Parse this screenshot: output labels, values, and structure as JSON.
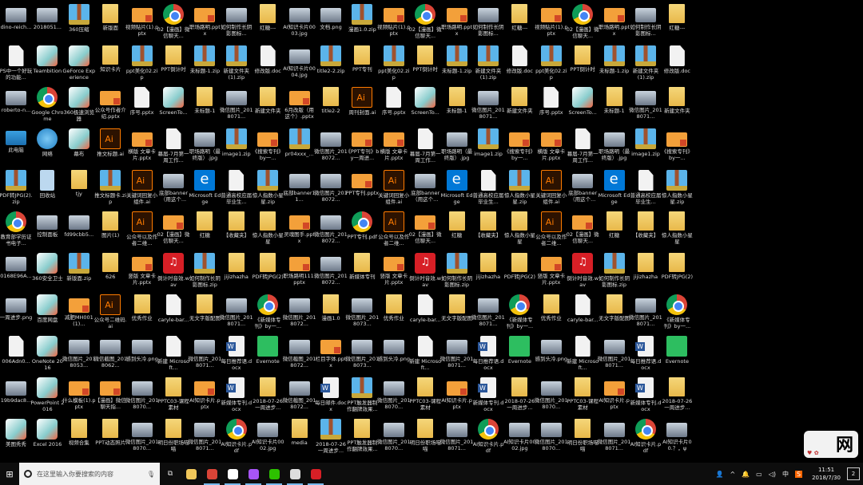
{
  "desktop": {
    "rows": [
      {
        "labels": [
          "dino-reich...",
          "2018051...",
          "360压缩",
          "新版面",
          "视频贴片(1).pptx",
          "02【漫画】微信聊天...",
          "职场路明.pptx",
          "如何制作长阴影图标...",
          "红糖---",
          "AI知识卡片0003.jpg",
          "文档.png",
          "漫画1.0.zip",
          "视频贴片(1).pptx",
          "02【漫画】微信聊天...",
          "职场路明.pptx",
          "如何制作长阴影图标...",
          "红糖---",
          "视频贴片(1).pptx",
          "02【漫画】微信聊天...",
          "职场路明.pptx",
          "如何制作长阴影图标...",
          "红糖---"
        ],
        "icons": [
          "img",
          "img",
          "zip",
          "folder",
          "ppt",
          "chrome",
          "ppt",
          "img",
          "folder",
          "img",
          "img",
          "zip",
          "ppt",
          "chrome",
          "ppt",
          "img",
          "folder",
          "ppt",
          "chrome",
          "ppt",
          "img",
          "folder"
        ]
      },
      {
        "labels": [
          "PS中一个好玩的功能...",
          "Teambition",
          "GeForce Experience",
          "知识卡片",
          "ppt美化02.zip",
          "PPT倒计时",
          "未标题-1.zip",
          "新建文件夹(1).zip",
          "修改版.doc",
          "AI知识卡片0004.jpg",
          "title2-2.zip",
          "PPT专刊",
          "ppt美化02.zip",
          "PPT倒计时",
          "未标题-1.zip",
          "新建文件夹(1).zip",
          "修改版.doc",
          "ppt美化02.zip",
          "PPT倒计时",
          "未标题-1.zip",
          "新建文件夹(1).zip",
          "修改版.doc"
        ],
        "icons": [
          "doc",
          "app",
          "app",
          "folder",
          "zip",
          "folder",
          "zip",
          "zip",
          "doc",
          "img",
          "zip",
          "folder",
          "zip",
          "folder",
          "zip",
          "zip",
          "doc",
          "zip",
          "folder",
          "zip",
          "zip",
          "doc"
        ]
      },
      {
        "labels": [
          "roberto-n...",
          "Google Chrome",
          "360极速浏览器",
          "公众号作者介绍.pptx",
          "序号.pptx",
          "ScreenTo...",
          "未标题-1",
          "微信图片_2018071...",
          "新建文件夹",
          "6月改版（用这个）.pptx",
          "title2-2",
          "周刊封面.ai",
          "序号.pptx",
          "ScreenTo...",
          "未标题-1",
          "微信图片_2018071...",
          "新建文件夹",
          "序号.pptx",
          "ScreenTo...",
          "未标题-1",
          "微信图片_2018071...",
          "新建文件夹"
        ],
        "icons": [
          "img",
          "chrome",
          "app",
          "ppt",
          "doc",
          "app",
          "folder",
          "img",
          "folder",
          "ppt",
          "folder",
          "ai",
          "doc",
          "app",
          "folder",
          "img",
          "folder",
          "doc",
          "app",
          "folder",
          "img",
          "folder"
        ]
      },
      {
        "labels": [
          "此电脑",
          "网络",
          "幕布",
          "推文标题.ai",
          "横版 文章卡片.pptx",
          "幕届-7月第一周工作...",
          "职场路明（最终版）.jpg",
          "image1.zip",
          "《搜索专刊》by一...",
          "pr04xxx_...",
          "微信图片_2018072...",
          "《PPT专刊》by一周进...",
          "横版 文章卡片.pptx",
          "幕届-7月第一周工作...",
          "职场路明（最终版）.jpg",
          "image1.zip",
          "《搜索专刊》by一...",
          "横版 文章卡片.pptx",
          "幕届-7月第一周工作...",
          "职场路明（最终版）.jpg",
          "image1.zip",
          "《搜索专刊》by一..."
        ],
        "icons": [
          "pc",
          "net",
          "app",
          "ai",
          "ppt",
          "doc",
          "img",
          "zip",
          "ppt",
          "zip",
          "img",
          "ppt",
          "ppt",
          "doc",
          "img",
          "zip",
          "ppt",
          "ppt",
          "doc",
          "img",
          "zip",
          "ppt"
        ]
      },
      {
        "labels": [
          "PDF转JPG(2).zip",
          "回收站",
          "tjy",
          "推文标题卡.zip",
          "关键词回复小组件.ai",
          "底部banner（用这个...",
          "Microsoft Edge",
          "普通高校应届毕业生...",
          "惊人指数小星星.zip",
          "底部banner11...",
          "微信图片_2018072...",
          "PPT专刊.pptx",
          "关键词回复小组件.ai",
          "底部banner（用这个...",
          "Microsoft Edge",
          "普通高校应届毕业生...",
          "惊人指数小星星.zip",
          "关键词回复小组件.ai",
          "底部banner（用这个...",
          "Microsoft Edge",
          "普通高校应届毕业生...",
          "惊人指数小星星.zip"
        ],
        "icons": [
          "zip",
          "recycle",
          "folder",
          "zip",
          "ai",
          "img",
          "edge",
          "doc",
          "zip",
          "img",
          "img",
          "ppt",
          "ai",
          "img",
          "edge",
          "doc",
          "zip",
          "ai",
          "img",
          "edge",
          "doc",
          "zip"
        ]
      },
      {
        "labels": [
          "教育部学历证书电子...",
          "控制面板",
          "fd99cbb5...",
          "图片(1)",
          "公众号以及作者二维...",
          "02【漫画】微信聊天...",
          "红糖",
          "【收藏夹】",
          "惊人指数小星星",
          "灵魂图手.pptx",
          "微信图片_2018072...",
          "PPT专刊.pdf",
          "公众号以及作者二维...",
          "02【漫画】微信聊天...",
          "红糖",
          "【收藏夹】",
          "惊人指数小星星",
          "公众号以及作者二维...",
          "02【漫画】微信聊天...",
          "红糖",
          "【收藏夹】",
          "惊人指数小星星"
        ],
        "icons": [
          "chrome",
          "img",
          "img",
          "folder",
          "ai",
          "ppt",
          "folder",
          "folder",
          "folder",
          "ppt",
          "img",
          "chrome",
          "ai",
          "ppt",
          "folder",
          "folder",
          "folder",
          "ai",
          "ppt",
          "folder",
          "folder",
          "folder"
        ]
      },
      {
        "labels": [
          "0168E96A...",
          "360安全卫士",
          "新版面.zip",
          "626",
          "竖版 文章卡片.pptx",
          "倒计时音效.wav",
          "如何制作长阴影图标.zip",
          "jijizhazha",
          "PDF转JPG(2)",
          "职场路明111.pptx",
          "微信图片_2018072...",
          "新媒体专刊",
          "竖版 文章卡片.pptx",
          "倒计时音效.wav",
          "如何制作长阴影图标.zip",
          "jijizhazha",
          "PDF转JPG(2)",
          "竖版 文章卡片.pptx",
          "倒计时音效.wav",
          "如何制作长阴影图标.zip",
          "jijizhazha",
          "PDF转JPG(2)"
        ],
        "icons": [
          "img",
          "app",
          "zip",
          "folder",
          "ppt",
          "music",
          "zip",
          "folder",
          "folder",
          "ppt",
          "img",
          "folder",
          "ppt",
          "music",
          "zip",
          "folder",
          "folder",
          "ppt",
          "music",
          "zip",
          "folder",
          "folder"
        ]
      },
      {
        "labels": [
          "一周进步.png",
          "百度网盘",
          "减肥MH001(1)...",
          "公众号二维码.ai",
          "优秀作业",
          "caryle-bar...",
          "无文字版配图",
          "微信图片_2018071...",
          "《新媒体专刊》by一...",
          "微信图片_2018072...",
          "漫画1.0",
          "微信图片_2018073...",
          "优秀作业",
          "caryle-bar...",
          "无文字版配图",
          "微信图片_2018071...",
          "《新媒体专刊》by一...",
          "优秀作业",
          "caryle-bar...",
          "无文字版配图",
          "微信图片_2018071...",
          "《新媒体专刊》by一..."
        ],
        "icons": [
          "img",
          "app",
          "ppt",
          "ai",
          "folder",
          "doc",
          "folder",
          "img",
          "chrome",
          "img",
          "folder",
          "img",
          "folder",
          "doc",
          "folder",
          "img",
          "chrome",
          "folder",
          "doc",
          "folder",
          "img",
          "chrome"
        ]
      },
      {
        "labels": [
          "006Adn0...",
          "OneNote 2016",
          "微信图片_2018053...",
          "微信截图_2018062...",
          "感到头冷.png",
          "新建 Microsoft...",
          "微信图片_2018071...",
          "每日推荐语.docx",
          "Evernote",
          "微信截图_2018072...",
          "栏目字体.pptx",
          "微信图片_2018073...",
          "感到头冷.png",
          "新建 Microsoft...",
          "微信图片_2018071...",
          "每日推荐语.docx",
          "Evernote",
          "感到头冷.png",
          "新建 Microsoft...",
          "微信图片_2018071...",
          "每日推荐语.docx",
          "Evernote"
        ],
        "icons": [
          "doc",
          "app",
          "img",
          "img",
          "img",
          "doc",
          "img",
          "word",
          "evernote",
          "img",
          "ppt",
          "img",
          "img",
          "doc",
          "img",
          "word",
          "evernote",
          "img",
          "doc",
          "img",
          "word",
          "evernote"
        ]
      },
      {
        "labels": [
          "19b9dac8...",
          "PowerPoint 2016",
          "什么模板(1).pptx",
          "【漫画】微信聊天指...",
          "微信图片_2018070...",
          "PPTC03-课程素材",
          "AI知识卡片.pptx",
          "新媒体专刊.docx",
          "2018-07-26一周进步...",
          "微信截图_2018072...",
          "每日邮件.docx",
          "PPT触发器制作翻牌效果...",
          "微信图片_2018070...",
          "PPTC03-课程素材",
          "AI知识卡片.pptx",
          "新媒体专刊.docx",
          "2018-07-26一周进步...",
          "微信图片_2018070...",
          "PPTC03-课程素材",
          "AI知识卡片.pptx",
          "新媒体专刊.docx",
          "2018-07-26一周进步..."
        ],
        "icons": [
          "img",
          "app",
          "ppt",
          "ppt",
          "img",
          "folder",
          "ppt",
          "word",
          "folder",
          "img",
          "word",
          "zip",
          "img",
          "folder",
          "ppt",
          "word",
          "folder",
          "img",
          "folder",
          "ppt",
          "word",
          "folder"
        ]
      },
      {
        "labels": [
          "美图秀秀",
          "Excel 2016",
          "视频合集",
          "PPT动态照片",
          "微信图片_2018070...",
          "明日份职场喵喵",
          "微信图片_2018071...",
          "AI知识卡片.pdf",
          "AI知识卡片0002.jpg",
          "media",
          "2018-07-26一周进步...",
          "PPT触发器制作翻牌效果...",
          "微信图片_2018070...",
          "明日份职场喵喵",
          "微信图片_2018071...",
          "AI知识卡片.pdf",
          "AI知识卡片0002.jpg",
          "微信图片_2018070...",
          "明日份职场喵喵",
          "微信图片_2018071...",
          "AI知识卡片.pdf",
          "AI知识卡片00.？，ψ"
        ],
        "icons": [
          "app",
          "app",
          "folder",
          "folder",
          "img",
          "folder",
          "img",
          "chrome",
          "img",
          "folder",
          "zip",
          "folder",
          "img",
          "folder",
          "img",
          "chrome",
          "img",
          "img",
          "folder",
          "img",
          "chrome",
          "img"
        ]
      }
    ]
  },
  "taskbar": {
    "search_placeholder": "在这里输入你要搜索的内容",
    "pinned": [
      {
        "name": "file-explorer",
        "color": "#f0c75a",
        "open": false
      },
      {
        "name": "chrome",
        "color": "#db4437",
        "open": true
      },
      {
        "name": "teambition",
        "color": "#ffffff",
        "open": true
      },
      {
        "name": "360-browser",
        "color": "#a855f7",
        "open": true
      },
      {
        "name": "wechat",
        "color": "#2dc100",
        "open": true
      },
      {
        "name": "mubu",
        "color": "#dddddd",
        "open": true
      },
      {
        "name": "netease-music",
        "color": "#d71f26",
        "open": true
      }
    ],
    "tray": {
      "ime": "中",
      "time": "11:51",
      "date": "2018/7/30",
      "notifications": "2"
    }
  },
  "watermark": {
    "text": "网"
  }
}
